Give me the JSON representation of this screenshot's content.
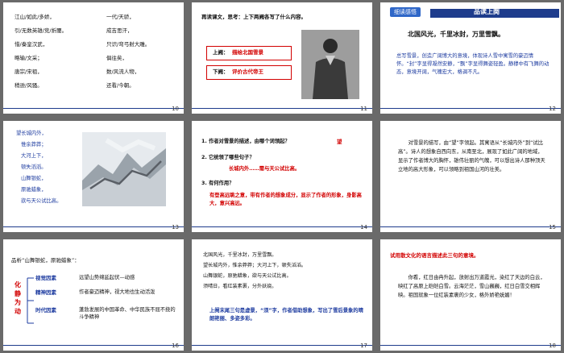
{
  "slides": [
    {
      "number": "10",
      "left_col": [
        "江山/如此/多娇，",
        "引/无数英雄/竞/折腰。",
        "惜/秦皇汉武，",
        "略输/文采；",
        "唐宗/宋祖，",
        "稍逊/风骚。"
      ],
      "right_col": [
        "一代/天骄，",
        "成吉思汗，",
        "只识/弯弓射大雕。",
        "俱往矣，",
        "数/风流人物，",
        "还看/今朝。"
      ]
    },
    {
      "number": "11",
      "question": "再读课文，思考：上下两阙各写了什么内容。",
      "upper_label": "上阙：",
      "upper_text": "描绘北国雪景",
      "lower_label": "下阙：",
      "lower_text": "评价古代帝王"
    },
    {
      "number": "12",
      "tab": "细读感悟",
      "header": "品读上阕",
      "line": "北国风光，千里冰封，万里雪飘。",
      "analysis": "总写雪景，创造广阔博大的意境，体现诗人雪中寓雪的豪迈情怀。“封”字显得凝然安静，“飘”字显得舞姿轻盈。静穆中有飞舞的动态，意境开阔，气魄宏大，格调不凡。"
    },
    {
      "number": "13",
      "lines": [
        "望长城内外，",
        "惟余莽莽；",
        "大河上下，",
        "顿失滔滔。",
        "山舞银蛇，",
        "原驰蜡象，",
        "欲与天公试比高。"
      ]
    },
    {
      "number": "14",
      "q1": "1. 作者对雪景的描述，由哪个词领起？",
      "a1": "望",
      "q2": "2. 它统领了哪些句子？",
      "a2": "长城内外……需与天公试比高。",
      "q3": "3. 有何作用？",
      "a3": "有登高远眺之意，带有作者的想象成分，显示了作者的形象，身影高大，意兴高远。"
    },
    {
      "number": "15",
      "text": "对雪景的描写，由“望”字领起。其寓语从“长城内外”到“试比高”。诗人的想象自西向东，从南至北，展现了如此广阔的地域，显示了作者博大的胸怀，雄伟壮丽的气魄，可以想出诗人那种顶天立地的高大形象，可以领略到祖国山河的壮美。"
    },
    {
      "number": "16",
      "title": "品析“山舞银蛇，原驰蜡象”：",
      "vertical": [
        "化",
        "静",
        "为",
        "动"
      ],
      "items": [
        {
          "label": "视觉因素",
          "desc": "远望山势绵延起伏—动感"
        },
        {
          "label": "精神因素",
          "desc": "作者豪迈精神，视大地也生动活泼"
        },
        {
          "label": "时代因素",
          "desc": "蓬勃发展的中国革命、中华民族不屈不挠的斗争精神"
        }
      ]
    },
    {
      "number": "17",
      "lines": [
        "北国风光，千里冰封，万里雪飘。",
        "望长城内外，惟余莽莽；大河上下，顿失滔滔。",
        "山舞银蛇，原驰蜡象，欲与天公试比高。",
        "须晴日，看红装素裹，分外妖娆。"
      ],
      "summary": "上阕末尾三句是虚景，“须”字，作者借助想象，写出了雪后景象的晴朗艳丽、多姿多彩。"
    },
    {
      "number": "18",
      "prompt": "试用散文化的语言描述此三句的意境。",
      "text": "你看，红日由冉升起，放射出万道霞光，染红了天边的白云，映红了高原上皑皑白雪。云海茫茫，雪山巍巍，红日白雪交相辉映。祖国就象一位红装素裹的少女，格外娇艳妩媚！"
    }
  ]
}
